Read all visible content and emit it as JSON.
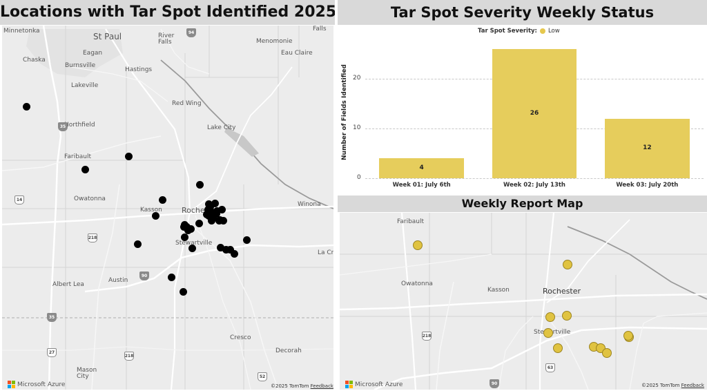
{
  "left_map": {
    "title": "Locations with Tar Spot Identified 2025",
    "places": [
      {
        "name": "Minnetonka",
        "size": 9
      },
      {
        "name": "Chaska",
        "size": 9
      },
      {
        "name": "St Paul",
        "size": 12
      },
      {
        "name": "Eagan",
        "size": 9
      },
      {
        "name": "Burnsville",
        "size": 9
      },
      {
        "name": "Hastings",
        "size": 9
      },
      {
        "name": "Lakeville",
        "size": 9
      },
      {
        "name": "River Falls",
        "size": 9
      },
      {
        "name": "Menomonie",
        "size": 9
      },
      {
        "name": "Eau Claire",
        "size": 9
      },
      {
        "name": "Falls",
        "size": 9
      },
      {
        "name": "Red Wing",
        "size": 9
      },
      {
        "name": "Northfield",
        "size": 9
      },
      {
        "name": "Lake City",
        "size": 9
      },
      {
        "name": "Faribault",
        "size": 9
      },
      {
        "name": "Owatonna",
        "size": 9
      },
      {
        "name": "Kasson",
        "size": 9
      },
      {
        "name": "Roche",
        "size": 11
      },
      {
        "name": "Winona",
        "size": 9
      },
      {
        "name": "Stewartville",
        "size": 9
      },
      {
        "name": "La Cre",
        "size": 9
      },
      {
        "name": "Albert Lea",
        "size": 9
      },
      {
        "name": "Austin",
        "size": 9
      },
      {
        "name": "Cresco",
        "size": 9
      },
      {
        "name": "Decorah",
        "size": 9
      },
      {
        "name": "Mason City",
        "size": 9
      }
    ],
    "highways": [
      {
        "label": "94",
        "kind": "interstate"
      },
      {
        "label": "35",
        "kind": "interstate"
      },
      {
        "label": "14",
        "kind": "us"
      },
      {
        "label": "218",
        "kind": "us"
      },
      {
        "label": "90",
        "kind": "interstate"
      },
      {
        "label": "35",
        "kind": "interstate"
      },
      {
        "label": "27",
        "kind": "us"
      },
      {
        "label": "218",
        "kind": "us"
      },
      {
        "label": "52",
        "kind": "us"
      }
    ],
    "point_count": 37,
    "point_color": "#000000",
    "attribution": {
      "copyright": "©2025 TomTom",
      "feedback": "Feedback",
      "brand": "Microsoft Azure"
    }
  },
  "chart": {
    "title": "Tar Spot Severity Weekly Status",
    "legend_title": "Tar Spot Severity:",
    "legend_item": "Low",
    "bar_color": "#e6cd5c",
    "y_ticks": [
      "0",
      "10",
      "20"
    ]
  },
  "chart_data": {
    "type": "bar",
    "categories": [
      "Week 01: July 6th",
      "Week 02: July 13th",
      "Week 03: July 20th"
    ],
    "series": [
      {
        "name": "Low",
        "values": [
          4,
          26,
          12
        ]
      }
    ],
    "title": "Tar Spot Severity Weekly Status",
    "xlabel": "",
    "ylabel": "Number of Fields Identified",
    "ylim": [
      0,
      27
    ],
    "grid": true,
    "legend": "top-center"
  },
  "right_map": {
    "title": "Weekly Report Map",
    "places": [
      {
        "name": "Faribault",
        "size": 9
      },
      {
        "name": "Owatonna",
        "size": 9
      },
      {
        "name": "Kasson",
        "size": 9
      },
      {
        "name": "Rochester",
        "size": 11
      },
      {
        "name": "Stewartville",
        "size": 9
      }
    ],
    "highways": [
      {
        "label": "218",
        "kind": "us"
      },
      {
        "label": "90",
        "kind": "interstate"
      },
      {
        "label": "63",
        "kind": "us"
      }
    ],
    "point_count": 11,
    "point_color": "#e0c341",
    "attribution": {
      "copyright": "©2025 TomTom",
      "feedback": "Feedback",
      "brand": "Microsoft Azure"
    }
  }
}
